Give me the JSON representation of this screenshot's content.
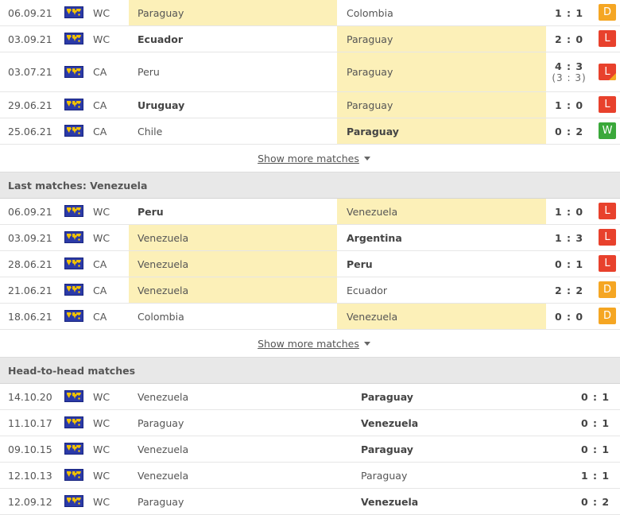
{
  "colors": {
    "L": "#e8412c",
    "D": "#f5a623",
    "W": "#3aa83a",
    "highlight": "#fcf0b8"
  },
  "icons": {
    "competition": "world-map-icon",
    "show_more": "caret-down-icon"
  },
  "sections": [
    {
      "title": "",
      "show_more": "Show more matches",
      "matches": [
        {
          "date": "06.09.21",
          "comp": "WC",
          "home": "Paraguay",
          "away": "Colombia",
          "score": "1 : 1",
          "result": "D",
          "hl": "home",
          "bold": ""
        },
        {
          "date": "03.09.21",
          "comp": "WC",
          "home": "Ecuador",
          "away": "Paraguay",
          "score": "2 : 0",
          "result": "L",
          "hl": "away",
          "bold": "home"
        },
        {
          "date": "03.07.21",
          "comp": "CA",
          "home": "Peru",
          "away": "Paraguay",
          "score": "4 : 3",
          "pen": "(3 : 3)",
          "result": "L",
          "hl": "away",
          "bold": "",
          "penalty_corner": true
        },
        {
          "date": "29.06.21",
          "comp": "CA",
          "home": "Uruguay",
          "away": "Paraguay",
          "score": "1 : 0",
          "result": "L",
          "hl": "away",
          "bold": "home"
        },
        {
          "date": "25.06.21",
          "comp": "CA",
          "home": "Chile",
          "away": "Paraguay",
          "score": "0 : 2",
          "result": "W",
          "hl": "away",
          "bold": "away"
        }
      ]
    },
    {
      "title": "Last matches: Venezuela",
      "show_more": "Show more matches",
      "matches": [
        {
          "date": "06.09.21",
          "comp": "WC",
          "home": "Peru",
          "away": "Venezuela",
          "score": "1 : 0",
          "result": "L",
          "hl": "away",
          "bold": "home"
        },
        {
          "date": "03.09.21",
          "comp": "WC",
          "home": "Venezuela",
          "away": "Argentina",
          "score": "1 : 3",
          "result": "L",
          "hl": "home",
          "bold": "away"
        },
        {
          "date": "28.06.21",
          "comp": "CA",
          "home": "Venezuela",
          "away": "Peru",
          "score": "0 : 1",
          "result": "L",
          "hl": "home",
          "bold": "away"
        },
        {
          "date": "21.06.21",
          "comp": "CA",
          "home": "Venezuela",
          "away": "Ecuador",
          "score": "2 : 2",
          "result": "D",
          "hl": "home",
          "bold": ""
        },
        {
          "date": "18.06.21",
          "comp": "CA",
          "home": "Colombia",
          "away": "Venezuela",
          "score": "0 : 0",
          "result": "D",
          "hl": "away",
          "bold": ""
        }
      ]
    },
    {
      "title": "Head-to-head matches",
      "h2h": true,
      "matches": [
        {
          "date": "14.10.20",
          "comp": "WC",
          "home": "Venezuela",
          "away": "Paraguay",
          "score": "0 : 1",
          "bold": "away"
        },
        {
          "date": "11.10.17",
          "comp": "WC",
          "home": "Paraguay",
          "away": "Venezuela",
          "score": "0 : 1",
          "bold": "away"
        },
        {
          "date": "09.10.15",
          "comp": "WC",
          "home": "Venezuela",
          "away": "Paraguay",
          "score": "0 : 1",
          "bold": "away"
        },
        {
          "date": "12.10.13",
          "comp": "WC",
          "home": "Venezuela",
          "away": "Paraguay",
          "score": "1 : 1",
          "bold": ""
        },
        {
          "date": "12.09.12",
          "comp": "WC",
          "home": "Paraguay",
          "away": "Venezuela",
          "score": "0 : 2",
          "bold": "away"
        }
      ]
    }
  ]
}
